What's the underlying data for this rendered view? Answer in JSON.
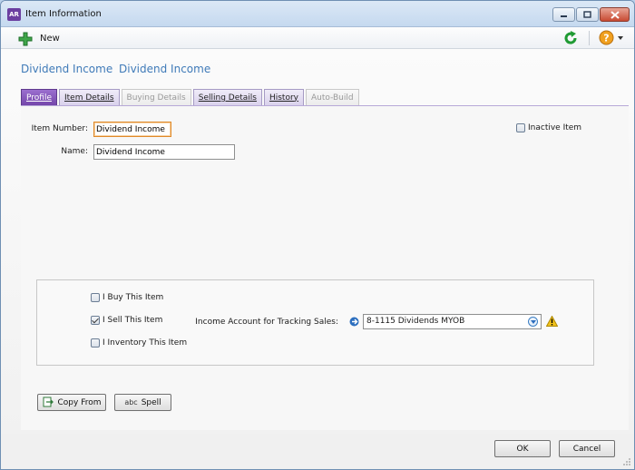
{
  "window": {
    "app_icon_text": "AR",
    "title": "Item Information"
  },
  "toolbar": {
    "new_label": "New"
  },
  "header": {
    "item_number": "Dividend Income",
    "item_name": "Dividend Income"
  },
  "tabs": [
    {
      "label": "Profile",
      "state": "active"
    },
    {
      "label": "Item Details",
      "state": "enabled"
    },
    {
      "label": "Buying Details",
      "state": "disabled"
    },
    {
      "label": "Selling Details",
      "state": "enabled"
    },
    {
      "label": "History",
      "state": "enabled"
    },
    {
      "label": "Auto-Build",
      "state": "disabled"
    }
  ],
  "profile": {
    "item_number_label": "Item Number:",
    "item_number_value": "Dividend Income",
    "name_label": "Name:",
    "name_value": "Dividend Income",
    "inactive_label": "Inactive Item",
    "inactive_checked": false
  },
  "usage": {
    "buy_label": "I Buy This Item",
    "buy_checked": false,
    "sell_label": "I Sell This Item",
    "sell_checked": true,
    "inventory_label": "I Inventory This Item",
    "inventory_checked": false,
    "income_account_label": "Income Account for Tracking Sales:",
    "income_account_value": "8-1115 Dividends MYOB"
  },
  "actions": {
    "copy_from_label": "Copy From",
    "spell_label": "Spell",
    "spell_icon_text": "abc"
  },
  "footer": {
    "ok_label": "OK",
    "cancel_label": "Cancel"
  },
  "colors": {
    "accent_purple": "#7446aa",
    "header_blue": "#3f7ab8",
    "warning_yellow": "#f2c21b"
  }
}
